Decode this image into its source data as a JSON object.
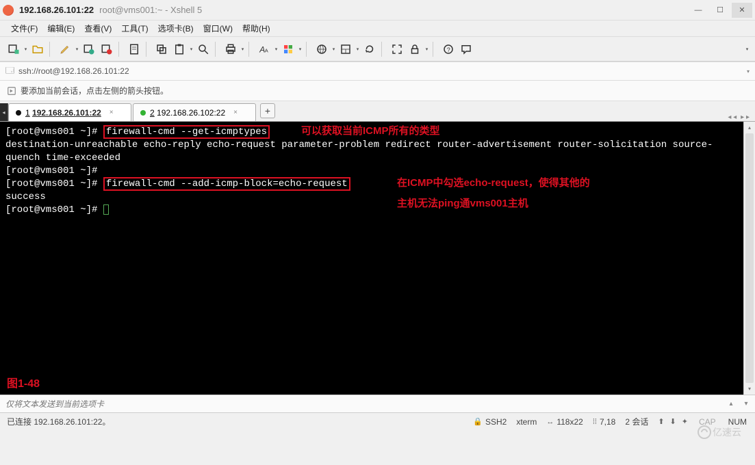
{
  "titlebar": {
    "title_main": "192.168.26.101:22",
    "title_sub": "root@vms001:~ - Xshell 5"
  },
  "menu": {
    "file": "文件(F)",
    "edit": "编辑(E)",
    "view": "查看(V)",
    "tools": "工具(T)",
    "tab": "选项卡(B)",
    "window": "窗口(W)",
    "help": "帮助(H)"
  },
  "toolbar_icons": {
    "new_session": "new-session-icon",
    "open": "open-icon",
    "pencil": "pencil-icon",
    "reconnect": "reconnect-icon",
    "disconnect": "disconnect-icon",
    "properties": "properties-icon",
    "copy": "copy-icon",
    "paste": "paste-icon",
    "search": "search-icon",
    "print": "print-icon",
    "font": "font-icon",
    "color": "color-icon",
    "globe": "globe-icon",
    "box1": "layout-icon",
    "refresh": "refresh-icon",
    "maximize": "fullscreen-icon",
    "lock": "lock-icon",
    "help": "help-icon",
    "chat": "chat-icon"
  },
  "addressbar": "ssh://root@192.168.26.101:22",
  "infobar": "要添加当前会话，点击左侧的箭头按钮。",
  "tabs": {
    "active": {
      "prefix": "1",
      "label": "192.168.26.101:22"
    },
    "inactive": {
      "prefix": "2",
      "label": "192.168.26.102:22"
    },
    "add": "+"
  },
  "terminal": {
    "line1_prefix": "[root@vms001 ~]# ",
    "line1_cmd": "firewall-cmd --get-icmptypes",
    "line2": "destination-unreachable echo-reply echo-request parameter-problem redirect router-advertisement router-solicitation source-quench time-exceeded",
    "line3": "[root@vms001 ~]#",
    "line4_prefix": "[root@vms001 ~]# ",
    "line4_cmd": "firewall-cmd --add-icmp-block=echo-request",
    "line5": "success",
    "line6": "[root@vms001 ~]# ",
    "annotations": {
      "a1": "可以获取当前ICMP所有的类型",
      "a2": "在ICMP中勾选echo-request，使得其他的",
      "a3": "主机无法ping通vms001主机",
      "figure": "图1-48"
    }
  },
  "input_placeholder": "仅将文本发送到当前选项卡",
  "status": {
    "left": "已连接 192.168.26.101:22。",
    "ssh": "SSH2",
    "term": "xterm",
    "size": "118x22",
    "pos": "7,18",
    "sessions": "2 会话"
  },
  "watermark": "亿速云"
}
